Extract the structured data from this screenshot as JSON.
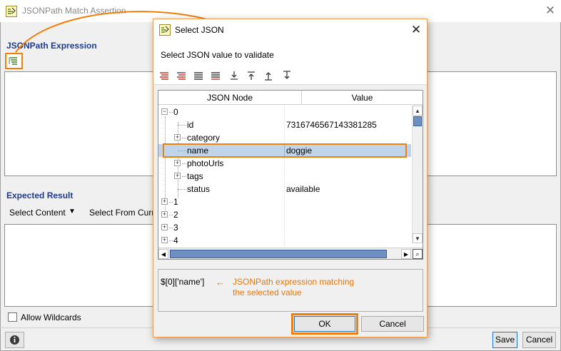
{
  "background_window": {
    "title": "JSONPath Match Assertion",
    "jsonpath_section_label": "JSONPath Expression",
    "expected_section_label": "Expected Result",
    "select_content_label": "Select Content",
    "select_from_current_label": "Select From Curr",
    "allow_wildcards_label": "Allow Wildcards",
    "save_label": "Save",
    "cancel_label": "Cancel",
    "info_icon": "info-icon"
  },
  "dialog": {
    "title": "Select JSON",
    "prompt": "Select JSON value to validate",
    "toolbar_icons": [
      "expand-all-icon",
      "collapse-all-icon",
      "expand-icon",
      "collapse-icon",
      "move-bottom-icon",
      "move-top-icon",
      "move-up-icon",
      "move-down-icon"
    ],
    "columns": [
      "JSON Node",
      "Value"
    ],
    "rows": [
      {
        "node": "0",
        "value": "",
        "expander": "⊟",
        "level": 0
      },
      {
        "node": "id",
        "value": "7316746567143381285",
        "expander": "",
        "level": 1
      },
      {
        "node": "category",
        "value": "",
        "expander": "+",
        "level": 1
      },
      {
        "node": "name",
        "value": "doggie",
        "expander": "",
        "level": 1,
        "selected": true
      },
      {
        "node": "photoUrls",
        "value": "",
        "expander": "+",
        "level": 1
      },
      {
        "node": "tags",
        "value": "",
        "expander": "+",
        "level": 1
      },
      {
        "node": "status",
        "value": "available",
        "expander": "",
        "level": 1
      },
      {
        "node": "1",
        "value": "",
        "expander": "+",
        "level": 0
      },
      {
        "node": "2",
        "value": "",
        "expander": "+",
        "level": 0
      },
      {
        "node": "3",
        "value": "",
        "expander": "+",
        "level": 0
      },
      {
        "node": "4",
        "value": "",
        "expander": "+",
        "level": 0
      }
    ],
    "expression": "$[0]['name']",
    "annotation_line1": "JSONPath expression matching",
    "annotation_line2": "the selected value",
    "ok_label": "OK",
    "cancel_label": "Cancel"
  },
  "colors": {
    "highlight_orange": "#f07f0c",
    "section_title_blue": "#1f3b8a",
    "selection_blue": "#c0d5ea"
  }
}
